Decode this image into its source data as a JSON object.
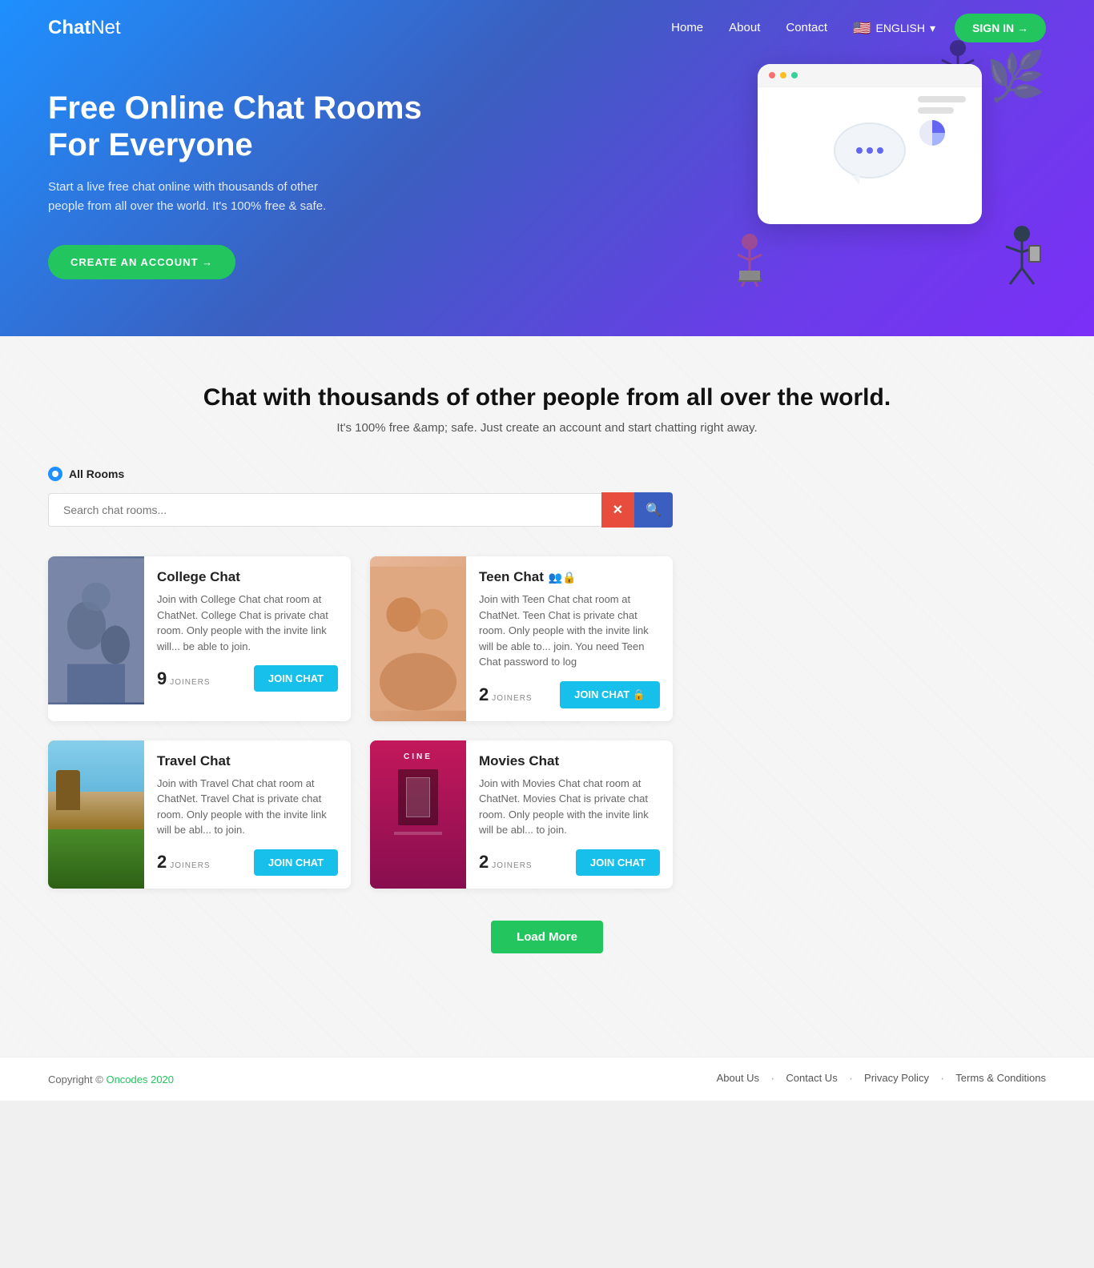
{
  "navbar": {
    "brand": "ChatNet",
    "brand_bold": "Chat",
    "nav_links": [
      "Home",
      "About",
      "Contact"
    ],
    "lang_label": "ENGLISH",
    "sign_in_label": "SIGN IN →"
  },
  "hero": {
    "title": "Free Online Chat Rooms For Everyone",
    "subtitle": "Start a live free chat online with thousands of other people from all over the world. It's 100% free & safe.",
    "cta_label": "CREATE AN ACCOUNT →"
  },
  "section": {
    "title": "Chat with thousands of other people from all over the world.",
    "subtitle": "It's 100% free &amp; safe. Just create an account and start chatting right away.",
    "filter_label": "All Rooms",
    "search_placeholder": "Search chat rooms...",
    "search_clear": "✕",
    "search_icon": "🔍"
  },
  "rooms": [
    {
      "id": "college",
      "name": "College Chat",
      "desc": "Join with College Chat chat room at ChatNet. College Chat is private chat room. Only people with the invite link will... be able to join.",
      "joiners": 9,
      "join_label": "JOIN CHAT",
      "locked": false,
      "img_class": "img-college"
    },
    {
      "id": "teen",
      "name": "Teen Chat",
      "desc": "Join with Teen Chat chat room at ChatNet. Teen Chat is private chat room. Only people with the invite link will be able to... join. You need Teen Chat password to log",
      "joiners": 2,
      "join_label": "JOIN CHAT 🔒",
      "locked": true,
      "img_class": "img-teen"
    },
    {
      "id": "travel",
      "name": "Travel Chat",
      "desc": "Join with Travel Chat chat room at ChatNet. Travel Chat is private chat room. Only people with the invite link will be abl... to join.",
      "joiners": 2,
      "join_label": "JOIN CHAT",
      "locked": false,
      "img_class": "img-travel"
    },
    {
      "id": "movies",
      "name": "Movies Chat",
      "desc": "Join with Movies Chat chat room at ChatNet. Movies Chat is private chat room. Only people with the invite link will be abl... to join.",
      "joiners": 2,
      "join_label": "JOIN CHAT",
      "locked": false,
      "img_class": "img-movies"
    }
  ],
  "load_more_label": "Load More",
  "footer": {
    "copy": "Copyright © Oncodes 2020",
    "links": [
      "About Us",
      "Contact Us",
      "Privacy Policy",
      "Terms & Conditions"
    ]
  }
}
